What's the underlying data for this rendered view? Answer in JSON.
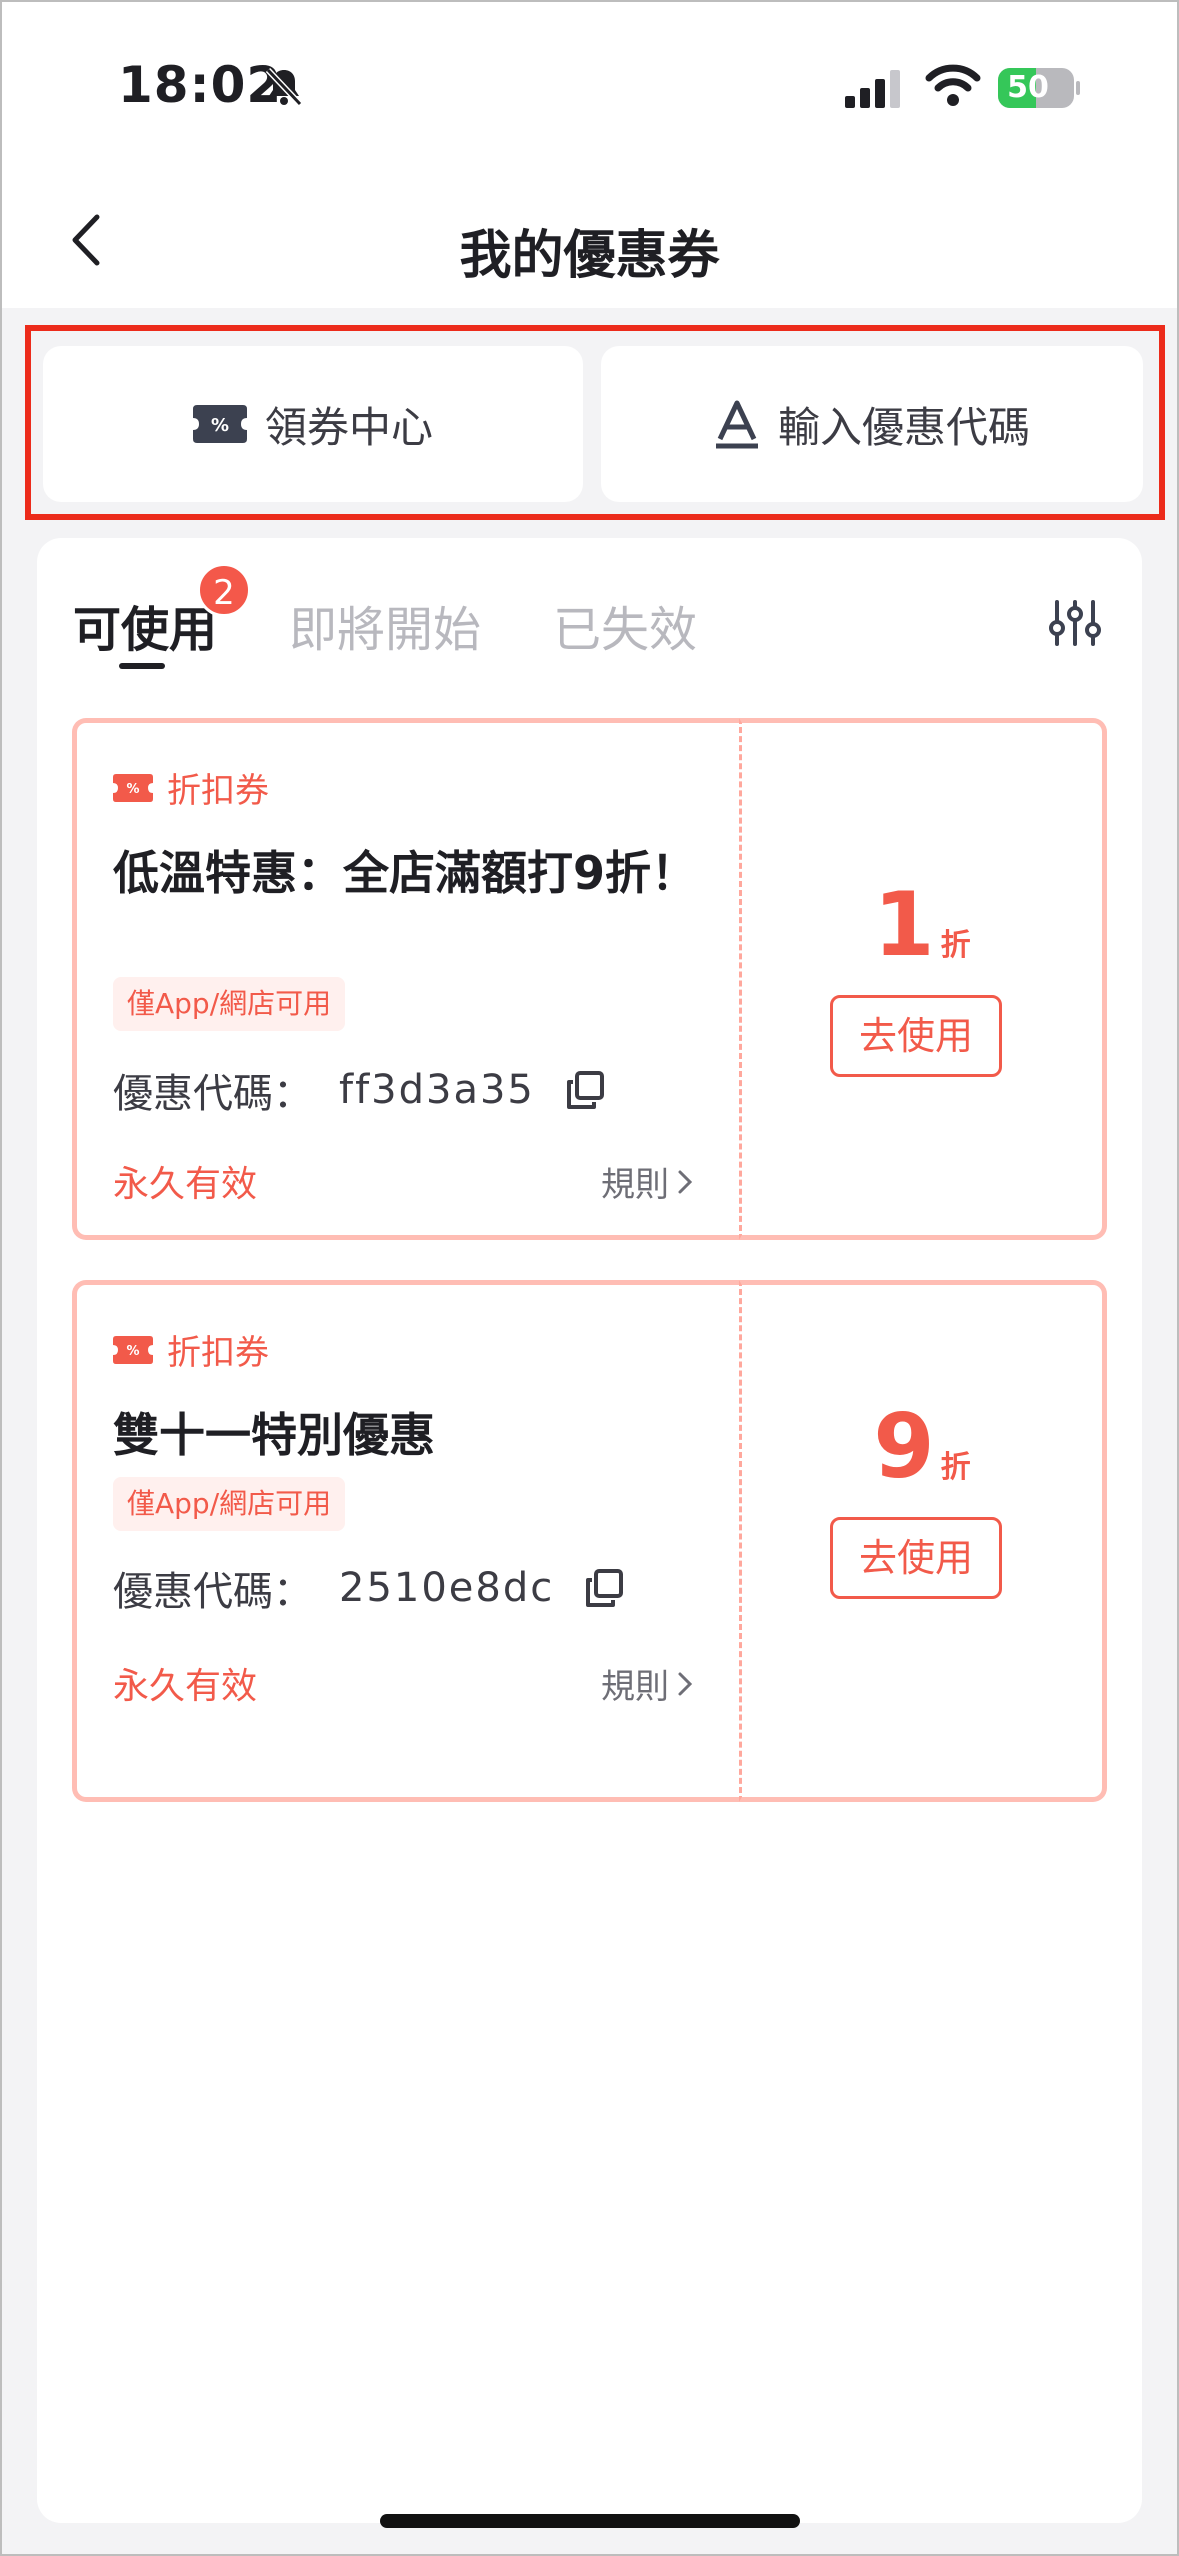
{
  "status_bar": {
    "time": "18:02",
    "battery": "50",
    "battery_level": 0.5
  },
  "nav": {
    "title": "我的優惠券"
  },
  "actions": {
    "claim_center": "領券中心",
    "enter_code": "輸入優惠代碼"
  },
  "tabs": [
    {
      "label": "可使用",
      "active": true,
      "badge": "2"
    },
    {
      "label": "即將開始",
      "active": false
    },
    {
      "label": "已失效",
      "active": false
    }
  ],
  "coupons": [
    {
      "type": "折扣券",
      "title": "低溫特惠：全店滿額打9折！",
      "tag": "僅App/網店可用",
      "code_label": "優惠代碼：",
      "code": "ff3d3a35",
      "validity": "永久有效",
      "rules": "規則",
      "discount": "1",
      "unit": "折",
      "use_label": "去使用"
    },
    {
      "type": "折扣券",
      "title": "雙十一特別優惠",
      "tag": "僅App/網店可用",
      "code_label": "優惠代碼：",
      "code": "2510e8dc",
      "validity": "永久有效",
      "rules": "規則",
      "discount": "9",
      "unit": "折",
      "use_label": "去使用"
    }
  ],
  "colors": {
    "accent": "#f25a4a",
    "highlight": "#ec2b1b",
    "card_border": "#ffbdb4"
  }
}
